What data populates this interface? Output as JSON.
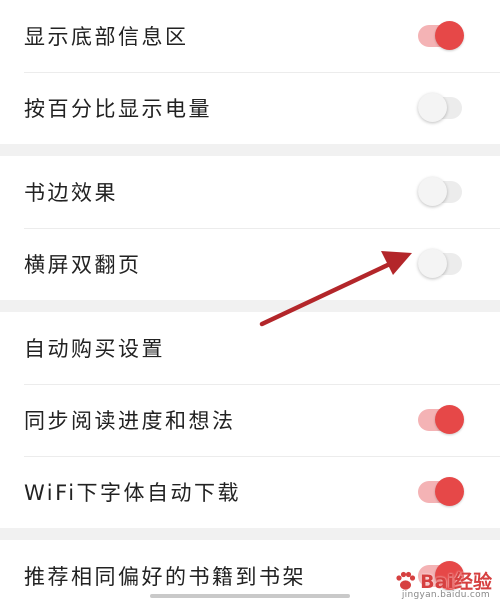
{
  "groups": [
    {
      "rows": [
        {
          "label": "显示底部信息区",
          "toggle": true,
          "on": true
        },
        {
          "label": "按百分比显示电量",
          "toggle": true,
          "on": false
        }
      ]
    },
    {
      "rows": [
        {
          "label": "书边效果",
          "toggle": true,
          "on": false
        },
        {
          "label": "横屏双翻页",
          "toggle": true,
          "on": false
        }
      ]
    },
    {
      "rows": [
        {
          "label": "自动购买设置",
          "toggle": false
        },
        {
          "label": "同步阅读进度和想法",
          "toggle": true,
          "on": true
        },
        {
          "label": "WiFi下字体自动下载",
          "toggle": true,
          "on": true
        }
      ]
    },
    {
      "rows": [
        {
          "label": "推荐相同偏好的书籍到书架",
          "toggle": true,
          "on": true
        }
      ]
    }
  ],
  "colors": {
    "accent": "#e64848",
    "track_on": "#f4b3b5",
    "track_off": "#ececec",
    "arrow": "#b3262a"
  },
  "watermark": {
    "text": "Bai经验",
    "sub": "jingyan.baidu.com",
    "icon": "paw-icon"
  }
}
